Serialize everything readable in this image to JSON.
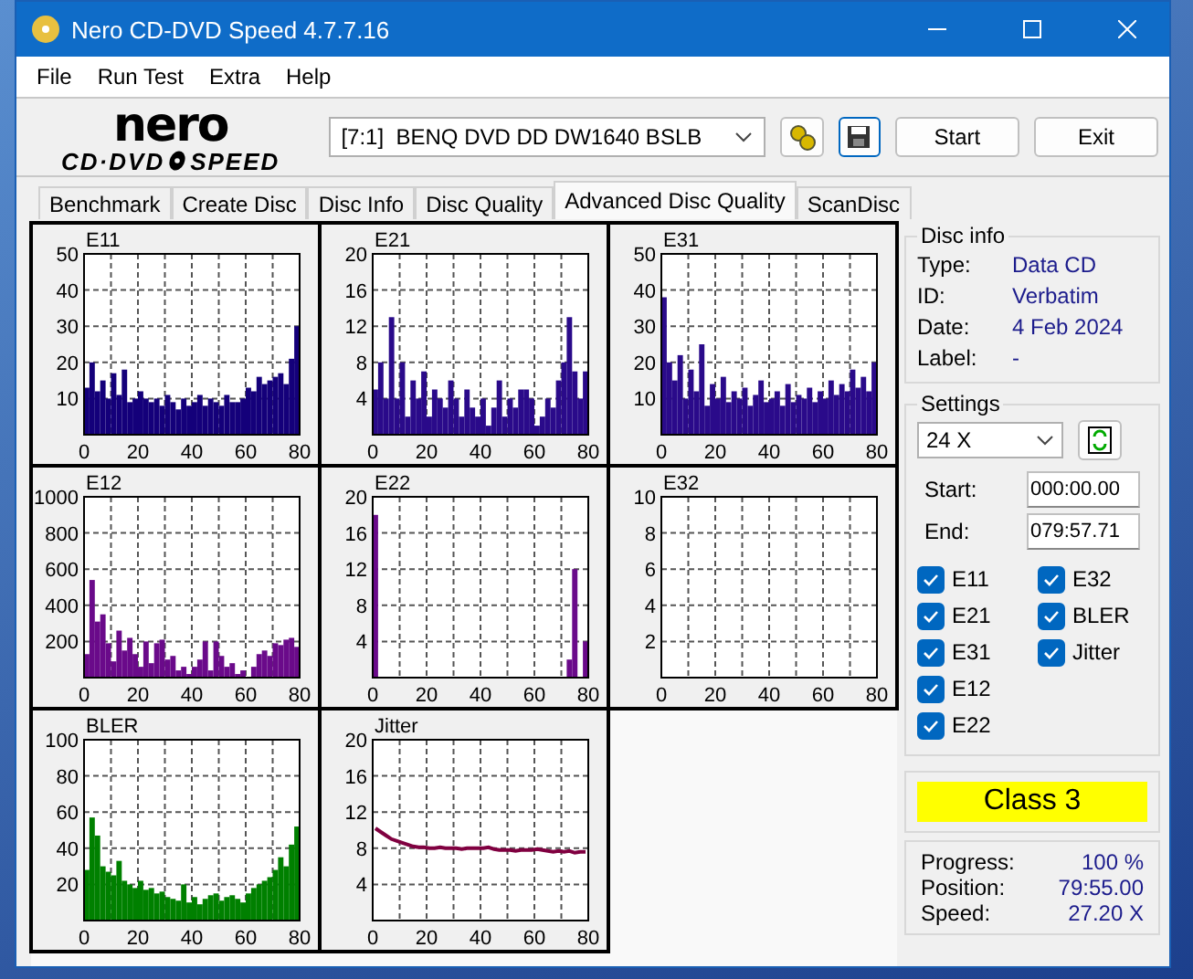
{
  "window": {
    "title": "Nero CD-DVD Speed 4.7.7.16"
  },
  "menu": [
    "File",
    "Run Test",
    "Extra",
    "Help"
  ],
  "toolbar": {
    "logo": {
      "top": "nero",
      "left": "CD·DVD",
      "right": "SPEED"
    },
    "drive": "[7:1]  BENQ DVD DD DW1640 BSLB",
    "buttons": [
      "Start",
      "Exit"
    ]
  },
  "tabs": [
    {
      "label": "Benchmark",
      "selected": false
    },
    {
      "label": "Create Disc",
      "selected": false
    },
    {
      "label": "Disc Info",
      "selected": false
    },
    {
      "label": "Disc Quality",
      "selected": false
    },
    {
      "label": "Advanced Disc Quality",
      "selected": true
    },
    {
      "label": "ScanDisc",
      "selected": false
    }
  ],
  "charts": [
    {
      "chart_data": {
        "type": "bar",
        "title": "E11",
        "grid": true,
        "x": [
          1,
          3,
          5,
          7,
          9,
          11,
          13,
          15,
          17,
          19,
          21,
          23,
          25,
          27,
          29,
          31,
          33,
          35,
          37,
          39,
          41,
          43,
          45,
          47,
          49,
          51,
          53,
          55,
          57,
          59,
          61,
          63,
          65,
          67,
          69,
          71,
          73,
          75,
          77,
          79
        ],
        "xlim": [
          0,
          80
        ],
        "ylim": [
          0,
          50
        ],
        "xticks": [
          0,
          20,
          40,
          60,
          80
        ],
        "yticks": [
          10,
          20,
          30,
          40,
          50
        ],
        "series": [
          {
            "color": "#14007a",
            "values": [
              13,
              20,
              12,
              15,
              10,
              17,
              11,
              18,
              9,
              10,
              12,
              10,
              9,
              10,
              8,
              11,
              9,
              7,
              10,
              8,
              9,
              11,
              8,
              10,
              9,
              8,
              11,
              9,
              9,
              10,
              13,
              12,
              16,
              14,
              15,
              16,
              17,
              14,
              21,
              30
            ]
          }
        ]
      }
    },
    {
      "chart_data": {
        "type": "bar",
        "title": "E21",
        "grid": true,
        "x": [
          1,
          3,
          5,
          7,
          9,
          11,
          13,
          15,
          17,
          19,
          21,
          23,
          25,
          27,
          29,
          31,
          33,
          35,
          37,
          39,
          41,
          43,
          45,
          47,
          49,
          51,
          53,
          55,
          57,
          59,
          61,
          63,
          65,
          67,
          69,
          71,
          73,
          75,
          77,
          79
        ],
        "xlim": [
          0,
          80
        ],
        "ylim": [
          0,
          20
        ],
        "xticks": [
          0,
          20,
          40,
          60,
          80
        ],
        "yticks": [
          4,
          8,
          12,
          16,
          20
        ],
        "series": [
          {
            "color": "#2a0a8a",
            "values": [
              5,
              8,
              4,
              13,
              4,
              8,
              2,
              6,
              4,
              7,
              2,
              5,
              4,
              3,
              6,
              4,
              2,
              5,
              3,
              2,
              4,
              1,
              3,
              6,
              2,
              4,
              3,
              5,
              5,
              4,
              1,
              2,
              4,
              3,
              6,
              8,
              13,
              7,
              4,
              7
            ]
          }
        ]
      }
    },
    {
      "chart_data": {
        "type": "bar",
        "title": "E31",
        "grid": true,
        "x": [
          1,
          3,
          5,
          7,
          9,
          11,
          13,
          15,
          17,
          19,
          21,
          23,
          25,
          27,
          29,
          31,
          33,
          35,
          37,
          39,
          41,
          43,
          45,
          47,
          49,
          51,
          53,
          55,
          57,
          59,
          61,
          63,
          65,
          67,
          69,
          71,
          73,
          75,
          77,
          79
        ],
        "xlim": [
          0,
          80
        ],
        "ylim": [
          0,
          50
        ],
        "xticks": [
          0,
          20,
          40,
          60,
          80
        ],
        "yticks": [
          10,
          20,
          30,
          40,
          50
        ],
        "series": [
          {
            "color": "#2a0a8a",
            "values": [
              38,
              20,
              15,
              22,
              10,
              18,
              12,
              25,
              8,
              14,
              10,
              16,
              9,
              12,
              10,
              13,
              8,
              11,
              15,
              9,
              10,
              12,
              8,
              14,
              9,
              11,
              10,
              13,
              9,
              12,
              10,
              15,
              11,
              14,
              12,
              18,
              13,
              16,
              12,
              20
            ]
          }
        ]
      }
    },
    {
      "chart_data": {
        "type": "bar",
        "title": "E12",
        "grid": true,
        "x": [
          1,
          3,
          5,
          7,
          9,
          11,
          13,
          15,
          17,
          19,
          21,
          23,
          25,
          27,
          29,
          31,
          33,
          35,
          37,
          39,
          41,
          43,
          45,
          47,
          49,
          51,
          53,
          55,
          57,
          59,
          61,
          63,
          65,
          67,
          69,
          71,
          73,
          75,
          77,
          79
        ],
        "xlim": [
          0,
          80
        ],
        "ylim": [
          0,
          1000
        ],
        "xticks": [
          0,
          20,
          40,
          60,
          80
        ],
        "yticks": [
          200,
          400,
          600,
          800,
          1000
        ],
        "series": [
          {
            "color": "#6a0a8a",
            "values": [
              130,
              540,
              310,
              350,
              190,
              90,
              260,
              150,
              220,
              130,
              60,
              200,
              80,
              190,
              210,
              100,
              120,
              40,
              60,
              20,
              60,
              100,
              200,
              40,
              200,
              120,
              60,
              80,
              20,
              40,
              0,
              60,
              130,
              150,
              120,
              190,
              180,
              210,
              220,
              170
            ]
          }
        ]
      }
    },
    {
      "chart_data": {
        "type": "bar",
        "title": "E22",
        "grid": true,
        "x": [
          1,
          3,
          5,
          7,
          9,
          11,
          13,
          15,
          17,
          19,
          21,
          23,
          25,
          27,
          29,
          31,
          33,
          35,
          37,
          39,
          41,
          43,
          45,
          47,
          49,
          51,
          53,
          55,
          57,
          59,
          61,
          63,
          65,
          67,
          69,
          71,
          73,
          75,
          77,
          79
        ],
        "xlim": [
          0,
          80
        ],
        "ylim": [
          0,
          20
        ],
        "xticks": [
          0,
          20,
          40,
          60,
          80
        ],
        "yticks": [
          4,
          8,
          12,
          16,
          20
        ],
        "series": [
          {
            "color": "#6a0a8a",
            "values": [
              18,
              0,
              0,
              0,
              0,
              0,
              0,
              0,
              0,
              0,
              0,
              0,
              0,
              0,
              0,
              0,
              0,
              0,
              0,
              0,
              0,
              0,
              0,
              0,
              0,
              0,
              0,
              0,
              0,
              0,
              0,
              0,
              0,
              0,
              0,
              0,
              2,
              12,
              0,
              4
            ]
          }
        ]
      }
    },
    {
      "chart_data": {
        "type": "bar",
        "title": "E32",
        "grid": true,
        "x": [
          1,
          3,
          5,
          7,
          9,
          11,
          13,
          15,
          17,
          19,
          21,
          23,
          25,
          27,
          29,
          31,
          33,
          35,
          37,
          39,
          41,
          43,
          45,
          47,
          49,
          51,
          53,
          55,
          57,
          59,
          61,
          63,
          65,
          67,
          69,
          71,
          73,
          75,
          77,
          79
        ],
        "xlim": [
          0,
          80
        ],
        "ylim": [
          0,
          10
        ],
        "xticks": [
          0,
          20,
          40,
          60,
          80
        ],
        "yticks": [
          2,
          4,
          6,
          8,
          10
        ],
        "series": [
          {
            "color": "#6a0a8a",
            "values": [
              0,
              0,
              0,
              0,
              0,
              0,
              0,
              0,
              0,
              0,
              0,
              0,
              0,
              0,
              0,
              0,
              0,
              0,
              0,
              0,
              0,
              0,
              0,
              0,
              0,
              0,
              0,
              0,
              0,
              0,
              0,
              0,
              0,
              0,
              0,
              0,
              0,
              0,
              0,
              0
            ]
          }
        ]
      }
    },
    {
      "chart_data": {
        "type": "bar",
        "title": "BLER",
        "grid": true,
        "x": [
          1,
          3,
          5,
          7,
          9,
          11,
          13,
          15,
          17,
          19,
          21,
          23,
          25,
          27,
          29,
          31,
          33,
          35,
          37,
          39,
          41,
          43,
          45,
          47,
          49,
          51,
          53,
          55,
          57,
          59,
          61,
          63,
          65,
          67,
          69,
          71,
          73,
          75,
          77,
          79
        ],
        "xlim": [
          0,
          80
        ],
        "ylim": [
          0,
          100
        ],
        "xticks": [
          0,
          20,
          40,
          60,
          80
        ],
        "yticks": [
          20,
          40,
          60,
          80,
          100
        ],
        "series": [
          {
            "color": "#008000",
            "values": [
              28,
              57,
              47,
              30,
              27,
              25,
              33,
              22,
              20,
              18,
              22,
              17,
              18,
              15,
              16,
              13,
              12,
              11,
              20,
              10,
              13,
              9,
              12,
              14,
              15,
              11,
              13,
              14,
              12,
              10,
              15,
              18,
              20,
              22,
              24,
              28,
              35,
              30,
              42,
              52
            ]
          }
        ]
      }
    },
    {
      "chart_data": {
        "type": "line",
        "title": "Jitter",
        "grid": true,
        "x": [
          1,
          3,
          5,
          7,
          9,
          11,
          13,
          15,
          17,
          19,
          21,
          23,
          25,
          27,
          29,
          31,
          33,
          35,
          37,
          39,
          41,
          43,
          45,
          47,
          49,
          51,
          53,
          55,
          57,
          59,
          61,
          63,
          65,
          67,
          69,
          71,
          73,
          75,
          77,
          79
        ],
        "xlim": [
          0,
          80
        ],
        "ylim": [
          0,
          20
        ],
        "xticks": [
          0,
          20,
          40,
          60,
          80
        ],
        "yticks": [
          4,
          8,
          12,
          16,
          20
        ],
        "series": [
          {
            "color": "#800040",
            "values": [
              10.2,
              9.8,
              9.4,
              9.0,
              8.8,
              8.6,
              8.4,
              8.2,
              8.1,
              8.1,
              8.0,
              8.0,
              8.1,
              8.0,
              8.0,
              8.0,
              7.9,
              8.0,
              8.0,
              8.0,
              8.0,
              8.1,
              7.9,
              7.8,
              7.8,
              7.8,
              7.7,
              7.8,
              7.8,
              7.8,
              7.9,
              7.8,
              7.7,
              7.6,
              7.7,
              7.6,
              7.7,
              7.5,
              7.6,
              7.6
            ]
          }
        ]
      }
    }
  ],
  "disc_info": {
    "title": "Disc info",
    "fields": [
      {
        "label": "Type:",
        "value": "Data CD"
      },
      {
        "label": "ID:",
        "value": "Verbatim"
      },
      {
        "label": "Date:",
        "value": "4 Feb 2024"
      },
      {
        "label": "Label:",
        "value": "-"
      }
    ]
  },
  "settings": {
    "title": "Settings",
    "speed": "24 X",
    "start_label": "Start:",
    "start": "000:00.00",
    "end_label": "End:",
    "end": "079:57.71",
    "checks": [
      {
        "label": "E11",
        "checked": true
      },
      {
        "label": "E21",
        "checked": true
      },
      {
        "label": "E31",
        "checked": true
      },
      {
        "label": "E12",
        "checked": true
      },
      {
        "label": "E22",
        "checked": true
      },
      {
        "label": "E32",
        "checked": true
      },
      {
        "label": "BLER",
        "checked": true
      },
      {
        "label": "Jitter",
        "checked": true
      }
    ]
  },
  "result": {
    "label": "Class 3"
  },
  "status": [
    {
      "label": "Progress:",
      "value": "100 %"
    },
    {
      "label": "Position:",
      "value": "79:55.00"
    },
    {
      "label": "Speed:",
      "value": "27.20 X"
    }
  ]
}
